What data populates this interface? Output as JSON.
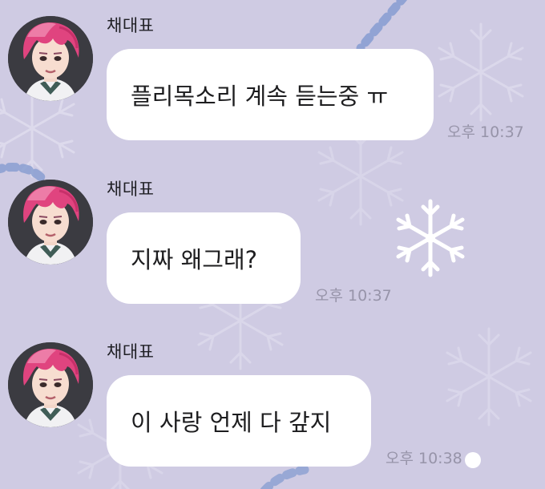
{
  "messages": [
    {
      "sender": "채대표",
      "text": "플리목소리 계속 듣는중 ㅠ",
      "time": "오후 10:37"
    },
    {
      "sender": "채대표",
      "text": "지짜 왜그래?",
      "time": "오후 10:37"
    },
    {
      "sender": "채대표",
      "text": "이 사랑 언제 다 갚지",
      "time": "오후 10:38"
    }
  ],
  "colors": {
    "background": "#cfcbe3",
    "bubble": "#ffffff",
    "time_text": "#9794a9",
    "hair": "#e0447f"
  },
  "icons": [
    "snowflake-icon"
  ]
}
